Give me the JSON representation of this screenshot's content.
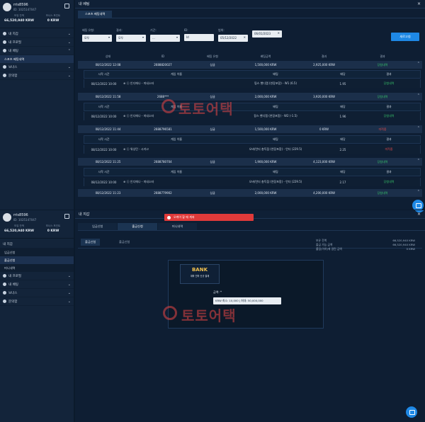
{
  "top": {
    "profile": {
      "name": "rris8596",
      "id": "ID: 1025147047",
      "balance_label": "보유 잔액",
      "balance": "66,520,940 KRW",
      "points_label": "보너스 포인트",
      "points": "0 KRW"
    },
    "menu": [
      {
        "label": "내 지갑",
        "icon": "wallet-icon",
        "chev": "⌄"
      },
      {
        "label": "내 프로필",
        "icon": "user-icon",
        "chev": "⌄"
      },
      {
        "label": "내 베팅",
        "icon": "bet-icon",
        "chev": "⌃"
      }
    ],
    "submenu_active": "스포츠 베팅내역",
    "menu2": [
      {
        "label": "보너스",
        "icon": "gift-icon",
        "chev": "⌄"
      },
      {
        "label": "문의함",
        "icon": "mail-icon",
        "chev": "⌄"
      }
    ],
    "header": "내 베팅",
    "tab": "스포츠 베팅내역",
    "filters": [
      {
        "label": "배팅 유형:",
        "value": "모두"
      },
      {
        "label": "결과:",
        "value": "모두"
      },
      {
        "label": "기간:",
        "value": "..."
      },
      {
        "label": "ID:",
        "value": "Id"
      },
      {
        "label": "범위:",
        "value": "05/12/2022"
      },
      {
        "label": "",
        "value": "06/01/2023"
      }
    ],
    "search_button": "새로고침",
    "columns": [
      "상태",
      "ID",
      "배팅 유형",
      "배팅금액",
      "결과",
      "결과"
    ],
    "bets": [
      {
        "date": "08/12/2022 12:08",
        "id": "2688820027",
        "type": "싱글",
        "amount": "1,500,000 KRW",
        "payout": "2,925,000 KRW",
        "status": "당첨내역",
        "status_class": "win"
      },
      {
        "date": "08/12/2022 11:58",
        "id": "2688***",
        "type": "싱글",
        "amount": "2,000,000 KRW",
        "payout": "3,920,000 KRW",
        "status": "당첨내역",
        "status_class": "win"
      },
      {
        "date": "08/12/2022 11:44",
        "id": "2688796581",
        "type": "싱글",
        "amount": "1,500,000 KRW",
        "payout": "0 KRW",
        "status": "미적중",
        "status_class": "lose"
      },
      {
        "date": "08/12/2022 11:25",
        "id": "2688780704",
        "type": "싱글",
        "amount": "1,900,000 KRW",
        "payout": "4,123,000 KRW",
        "status": "당첨내역",
        "status_class": "win"
      },
      {
        "date": "08/12/2022 11:23",
        "id": "2688779902",
        "type": "싱글",
        "amount": "2,000,000 KRW",
        "payout": "4,200,000 KRW",
        "status": "당첨내역",
        "status_class": "win"
      }
    ],
    "inner_headers": [
      "시작 시간",
      "게임 이름",
      "배팅",
      "배당",
      "결과"
    ],
    "details": [
      {
        "start": "08/12/2022 10:00",
        "game": "⊕ ⓢ 인디애나 - 미네소타",
        "pick": "핑스 핸디캡 (연장포함) - W1 (6.5)",
        "odds": "1.95",
        "result": "당첨내역",
        "result_class": "win"
      },
      {
        "start": "08/12/2022 10:00",
        "game": "⊕ ⓢ 인디애나 - 미네소타",
        "pick": "핑스 핸디캡 (연장포함) - W2 (-1.5)",
        "odds": "1.96",
        "result": "당첨내역",
        "result_class": "win"
      },
      {
        "start": "08/12/2022 10:00",
        "game": "⊕ ⓢ 워싱턴 - 시카고",
        "pick": "오버/언더 총득점 (연장포함) - 언더 (229.5)",
        "odds": "2.25",
        "result": "미적중",
        "result_class": "lose"
      },
      {
        "start": "08/12/2022 10:00",
        "game": "⊕ ⓢ 인디애나 - 미네소타",
        "pick": "오버/언더 총득점 (연장포함) - 언더 (229.5)",
        "odds": "2.17",
        "result": "당첨내역",
        "result_class": "win"
      }
    ],
    "watermark": "토토어택"
  },
  "bottom": {
    "profile": {
      "name": "rris8596",
      "id": "ID: 1025147047",
      "balance_label": "보유 잔액",
      "balance": "66,520,940 KRW",
      "points_label": "보너스 포인트",
      "points": "0 KRW"
    },
    "wallet_label": "내 지갑",
    "submenu": [
      "입금신청",
      "출금신청",
      "머니내역"
    ],
    "menu": [
      {
        "label": "내 프로필",
        "icon": "user-icon",
        "chev": "⌄"
      },
      {
        "label": "내 베팅",
        "icon": "bet-icon",
        "chev": "⌄"
      },
      {
        "label": "보너스",
        "icon": "gift-icon",
        "chev": "⌄"
      },
      {
        "label": "문의함",
        "icon": "mail-icon",
        "chev": "⌄"
      }
    ],
    "header": "내 지갑",
    "toast": "오케이 할 때 계좌",
    "tabs": [
      "입금신청",
      "출금신청",
      "머니내역"
    ],
    "subtab": "출금신청",
    "subtab2": "출금신청",
    "summary": [
      {
        "label": "보유 잔액",
        "value": "66,520,940 KRW"
      },
      {
        "label": "출금 가능 금액",
        "value": "66,520,940 KRW"
      },
      {
        "label": "롤링(이하)에 걸린 금액",
        "value": "0 KRW"
      }
    ],
    "bank_title": "BANK",
    "bank_sub": "계좌 인하 신규 결제",
    "amount_label": "금액: *",
    "amount_placeholder": "KRW 최소: 10,000 | 최대: 50,000,000",
    "watermark": "토토어택"
  }
}
